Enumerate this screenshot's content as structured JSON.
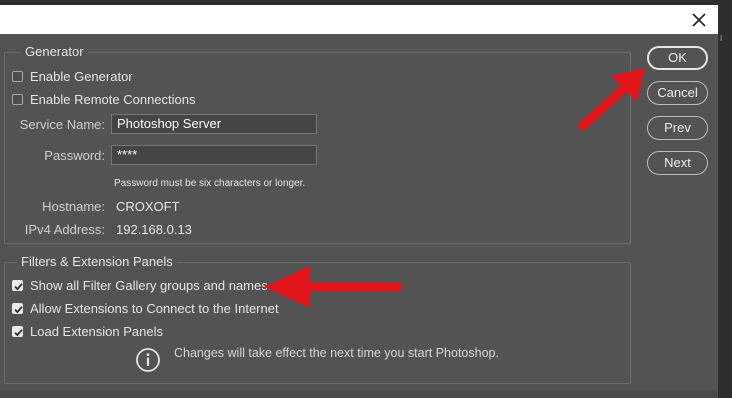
{
  "generator": {
    "title": "Generator",
    "enable_generator": {
      "label": "Enable Generator",
      "checked": false
    },
    "enable_remote": {
      "label": "Enable Remote Connections",
      "checked": false
    },
    "service_name": {
      "label": "Service Name:",
      "value": "Photoshop Server"
    },
    "password": {
      "label": "Password:",
      "value": "****",
      "note": "Password must be six characters or longer."
    },
    "hostname": {
      "label": "Hostname:",
      "value": "CROXOFT"
    },
    "ipv4": {
      "label": "IPv4 Address:",
      "value": "192.168.0.13"
    }
  },
  "filters": {
    "title": "Filters & Extension Panels",
    "show_all_filter": {
      "label": "Show all Filter Gallery groups and names",
      "checked": true
    },
    "allow_ext": {
      "label": "Allow Extensions to Connect to the Internet",
      "checked": true
    },
    "load_ext": {
      "label": "Load Extension Panels",
      "checked": true
    },
    "info": "Changes will take effect the next time you start Photoshop."
  },
  "buttons": {
    "ok": "OK",
    "cancel": "Cancel",
    "prev": "Prev",
    "next": "Next"
  },
  "colors": {
    "annotation_arrow": "#e3161c",
    "dialog_bg": "#535353"
  }
}
